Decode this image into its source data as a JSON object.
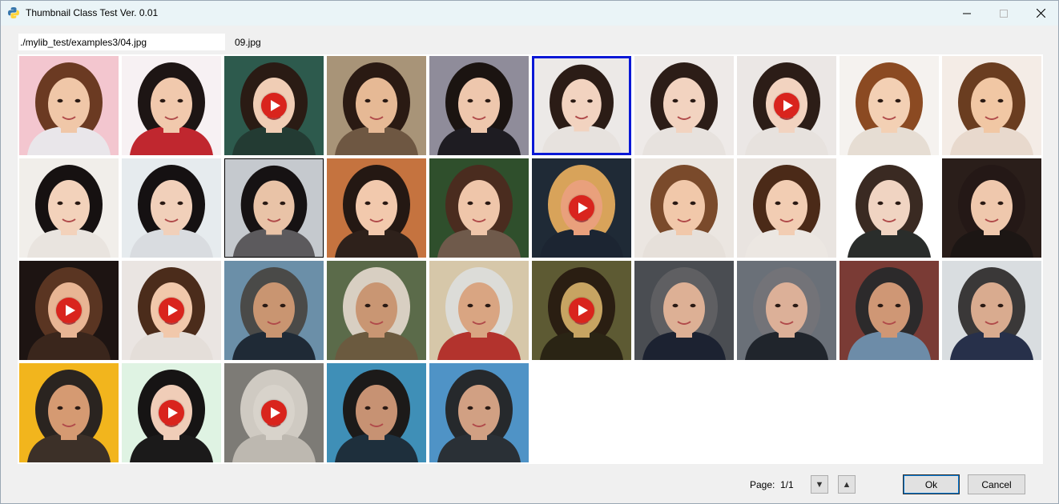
{
  "window": {
    "title": "Thumbnail Class Test Ver. 0.01"
  },
  "path_field": {
    "value": "./mylib_test/examples3/04.jpg"
  },
  "selected_file": "09.jpg",
  "thumbnails": [
    {
      "bg": "#f3c6cf",
      "hair": "#6b3a22",
      "skin": "#f0c7a8",
      "cloth": "#e9e6ea",
      "video": false
    },
    {
      "bg": "#f7f1f3",
      "hair": "#1d1514",
      "skin": "#f1c9ad",
      "cloth": "#c0272f",
      "video": false
    },
    {
      "bg": "#2d5a4d",
      "hair": "#2a1b14",
      "skin": "#f0cdb5",
      "cloth": "#233b33",
      "video": true
    },
    {
      "bg": "#a89478",
      "hair": "#2a1a13",
      "skin": "#e6b995",
      "cloth": "#6e5742",
      "video": false
    },
    {
      "bg": "#8f8c9a",
      "hair": "#1b1411",
      "skin": "#eec7ad",
      "cloth": "#1e1c22",
      "video": false
    },
    {
      "bg": "#ece9e7",
      "hair": "#2b1c16",
      "skin": "#f2d3c0",
      "cloth": "#e7e2de",
      "video": false
    },
    {
      "bg": "#eeeae8",
      "hair": "#2c1d17",
      "skin": "#f2d3c0",
      "cloth": "#e7e2de",
      "video": false
    },
    {
      "bg": "#ebe7e5",
      "hair": "#2c1d17",
      "skin": "#f2d3c0",
      "cloth": "#e7e2de",
      "video": true
    },
    {
      "bg": "#f5f2ef",
      "hair": "#8b4a22",
      "skin": "#f3d0b4",
      "cloth": "#e6ddd3",
      "video": false
    },
    {
      "bg": "#f4ece6",
      "hair": "#6a3d20",
      "skin": "#f1c7a4",
      "cloth": "#e8d9cd",
      "video": false
    },
    {
      "bg": "#f1eeea",
      "hair": "#161111",
      "skin": "#f3d2bb",
      "cloth": "#e9e4df",
      "video": false
    },
    {
      "bg": "#e6ebee",
      "hair": "#151112",
      "skin": "#f1d0ba",
      "cloth": "#d9dce0",
      "video": false
    },
    {
      "bg": "#c5c9ce",
      "hair": "#161213",
      "skin": "#e9c3a7",
      "cloth": "#5c5a5d",
      "video": false
    },
    {
      "bg": "#c5733f",
      "hair": "#241813",
      "skin": "#f2c9ad",
      "cloth": "#2e211b",
      "video": false
    },
    {
      "bg": "#2f4f2c",
      "hair": "#4a2c1f",
      "skin": "#efc6aa",
      "cloth": "#6f5a4b",
      "video": false
    },
    {
      "bg": "#1f2a36",
      "hair": "#d8a35a",
      "skin": "#e9a07c",
      "cloth": "#1c2532",
      "video": true
    },
    {
      "bg": "#ebe6e1",
      "hair": "#7a4a2b",
      "skin": "#f1c8aa",
      "cloth": "#e6e0da",
      "video": false
    },
    {
      "bg": "#e9e4e0",
      "hair": "#4b2a18",
      "skin": "#f2cdb3",
      "cloth": "#ece7e2",
      "video": false
    },
    {
      "bg": "#ffffff",
      "hair": "#3a2a22",
      "skin": "#f0d4c2",
      "cloth": "#2a2d2b",
      "video": false
    },
    {
      "bg": "#2a1e1a",
      "hair": "#241816",
      "skin": "#efc8ad",
      "cloth": "#1c1614",
      "video": false
    },
    {
      "bg": "#1d1412",
      "hair": "#5a3522",
      "skin": "#e8b594",
      "cloth": "#3a261c",
      "video": true
    },
    {
      "bg": "#eae5e2",
      "hair": "#4b2c1b",
      "skin": "#f1c8ab",
      "cloth": "#e4ded9",
      "video": true
    },
    {
      "bg": "#6b8fa8",
      "hair": "#4a4a48",
      "skin": "#c99571",
      "cloth": "#1f2a36",
      "video": false
    },
    {
      "bg": "#5b6b4a",
      "hair": "#d8cfc2",
      "skin": "#c99673",
      "cloth": "#6b5a3f",
      "video": false
    },
    {
      "bg": "#d6c7a9",
      "hair": "#dcdcd8",
      "skin": "#d9a582",
      "cloth": "#b3332d",
      "video": false
    },
    {
      "bg": "#5d5a33",
      "hair": "#2a1e12",
      "skin": "#c7a462",
      "cloth": "#2a2414",
      "video": true
    },
    {
      "bg": "#4a4d52",
      "hair": "#5f5f62",
      "skin": "#ddb095",
      "cloth": "#1c2231",
      "video": false
    },
    {
      "bg": "#6a7078",
      "hair": "#737378",
      "skin": "#dcb098",
      "cloth": "#20252c",
      "video": false
    },
    {
      "bg": "#7a3b35",
      "hair": "#2c2a2b",
      "skin": "#cf9775",
      "cloth": "#6d8ca8",
      "video": false
    },
    {
      "bg": "#d9dde0",
      "hair": "#3a3838",
      "skin": "#d9ab8f",
      "cloth": "#27304a",
      "video": false
    },
    {
      "bg": "#f2b51d",
      "hair": "#2a2420",
      "skin": "#d59a72",
      "cloth": "#3c3028",
      "video": false
    },
    {
      "bg": "#dff3e3",
      "hair": "#161414",
      "skin": "#f0cdb8",
      "cloth": "#1b1a1a",
      "video": true
    },
    {
      "bg": "#7d7b76",
      "hair": "#cfcac2",
      "skin": "#d8d3cb",
      "cloth": "#bdb8b0",
      "video": true
    },
    {
      "bg": "#3f8fb7",
      "hair": "#1c1a19",
      "skin": "#c79273",
      "cloth": "#1e2f3c",
      "video": false
    },
    {
      "bg": "#4f93c6",
      "hair": "#26292c",
      "skin": "#d1a083",
      "cloth": "#2a3036",
      "video": false
    }
  ],
  "pager": {
    "label": "Page:",
    "value": "1/1",
    "down_icon": "▼",
    "up_icon": "▲"
  },
  "buttons": {
    "ok": "Ok",
    "cancel": "Cancel"
  }
}
